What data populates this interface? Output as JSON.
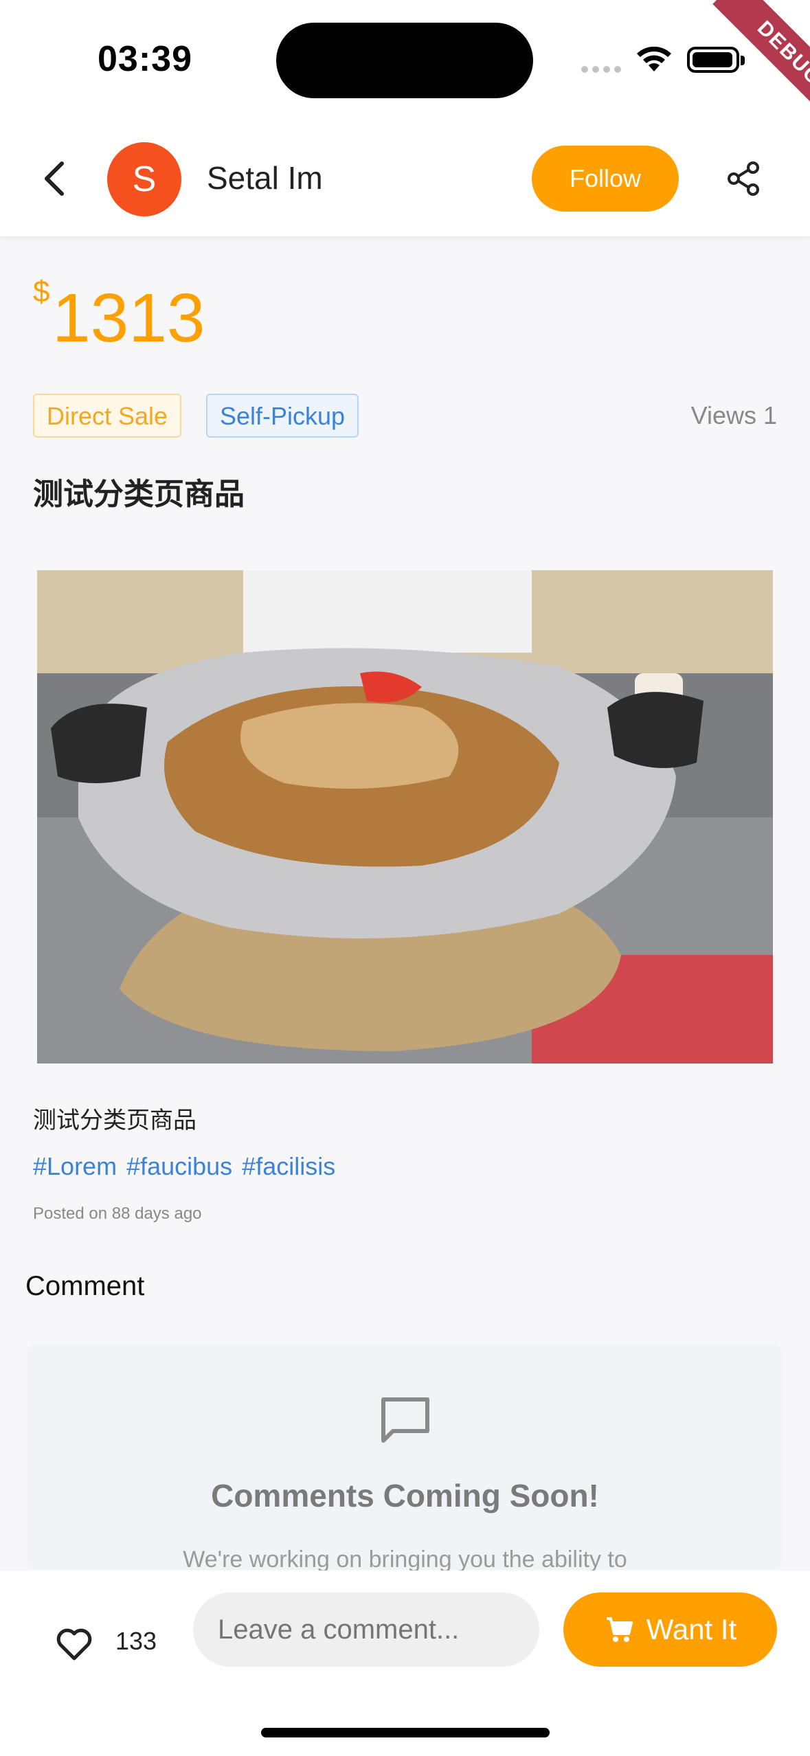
{
  "status_bar": {
    "time": "03:39",
    "debug_label": "DEBUG"
  },
  "header": {
    "avatar_letter": "S",
    "username": "Setal Im",
    "follow_label": "Follow"
  },
  "product": {
    "currency": "$",
    "price": "1313",
    "tags": [
      "Direct Sale",
      "Self-Pickup"
    ],
    "views": "Views 1",
    "title": "测试分类页商品",
    "description": "测试分类页商品",
    "hashtags": [
      "#Lorem",
      "#faucibus",
      "#facilisis"
    ],
    "posted": "Posted on 88 days ago"
  },
  "comments": {
    "section_title": "Comment",
    "placeholder_title": "Comments Coming Soon!",
    "placeholder_text": "We're working on bringing you the ability to"
  },
  "bottom_bar": {
    "like_count": "133",
    "comment_placeholder": "Leave a comment...",
    "want_label": "Want It"
  },
  "colors": {
    "accent": "#ffa000",
    "avatar": "#f4511e",
    "link": "#3b82d9"
  }
}
